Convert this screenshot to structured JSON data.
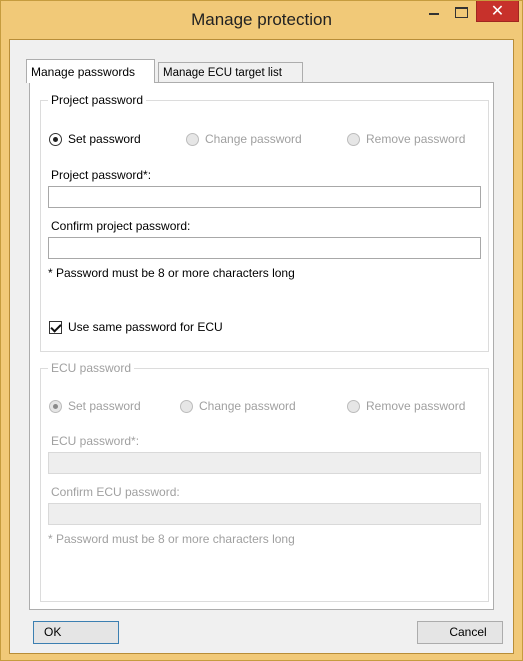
{
  "window": {
    "title": "Manage protection",
    "close_glyph": "✕"
  },
  "tabs": [
    {
      "label": "Manage passwords",
      "active": true
    },
    {
      "label": "Manage ECU target list",
      "active": false
    }
  ],
  "project_password": {
    "legend": "Project password",
    "radios": [
      {
        "label": "Set password",
        "checked": true
      },
      {
        "label": "Change password",
        "checked": false,
        "disabled": true
      },
      {
        "label": "Remove password",
        "checked": false,
        "disabled": true
      }
    ],
    "password_label": "Project password*:",
    "password_value": "",
    "confirm_label": "Confirm project password:",
    "confirm_value": "",
    "note": "* Password must be 8 or more characters long",
    "use_same_label": "Use same password for ECU",
    "use_same_checked": true
  },
  "ecu_password": {
    "legend": "ECU password",
    "disabled": true,
    "radios": [
      {
        "label": "Set password",
        "checked": true
      },
      {
        "label": "Change password",
        "checked": false
      },
      {
        "label": "Remove password",
        "checked": false
      }
    ],
    "password_label": "ECU password*:",
    "password_value": "",
    "confirm_label": "Confirm ECU password:",
    "confirm_value": "",
    "note": "* Password must be 8 or more characters long"
  },
  "buttons": {
    "ok": "OK",
    "cancel": "Cancel"
  }
}
